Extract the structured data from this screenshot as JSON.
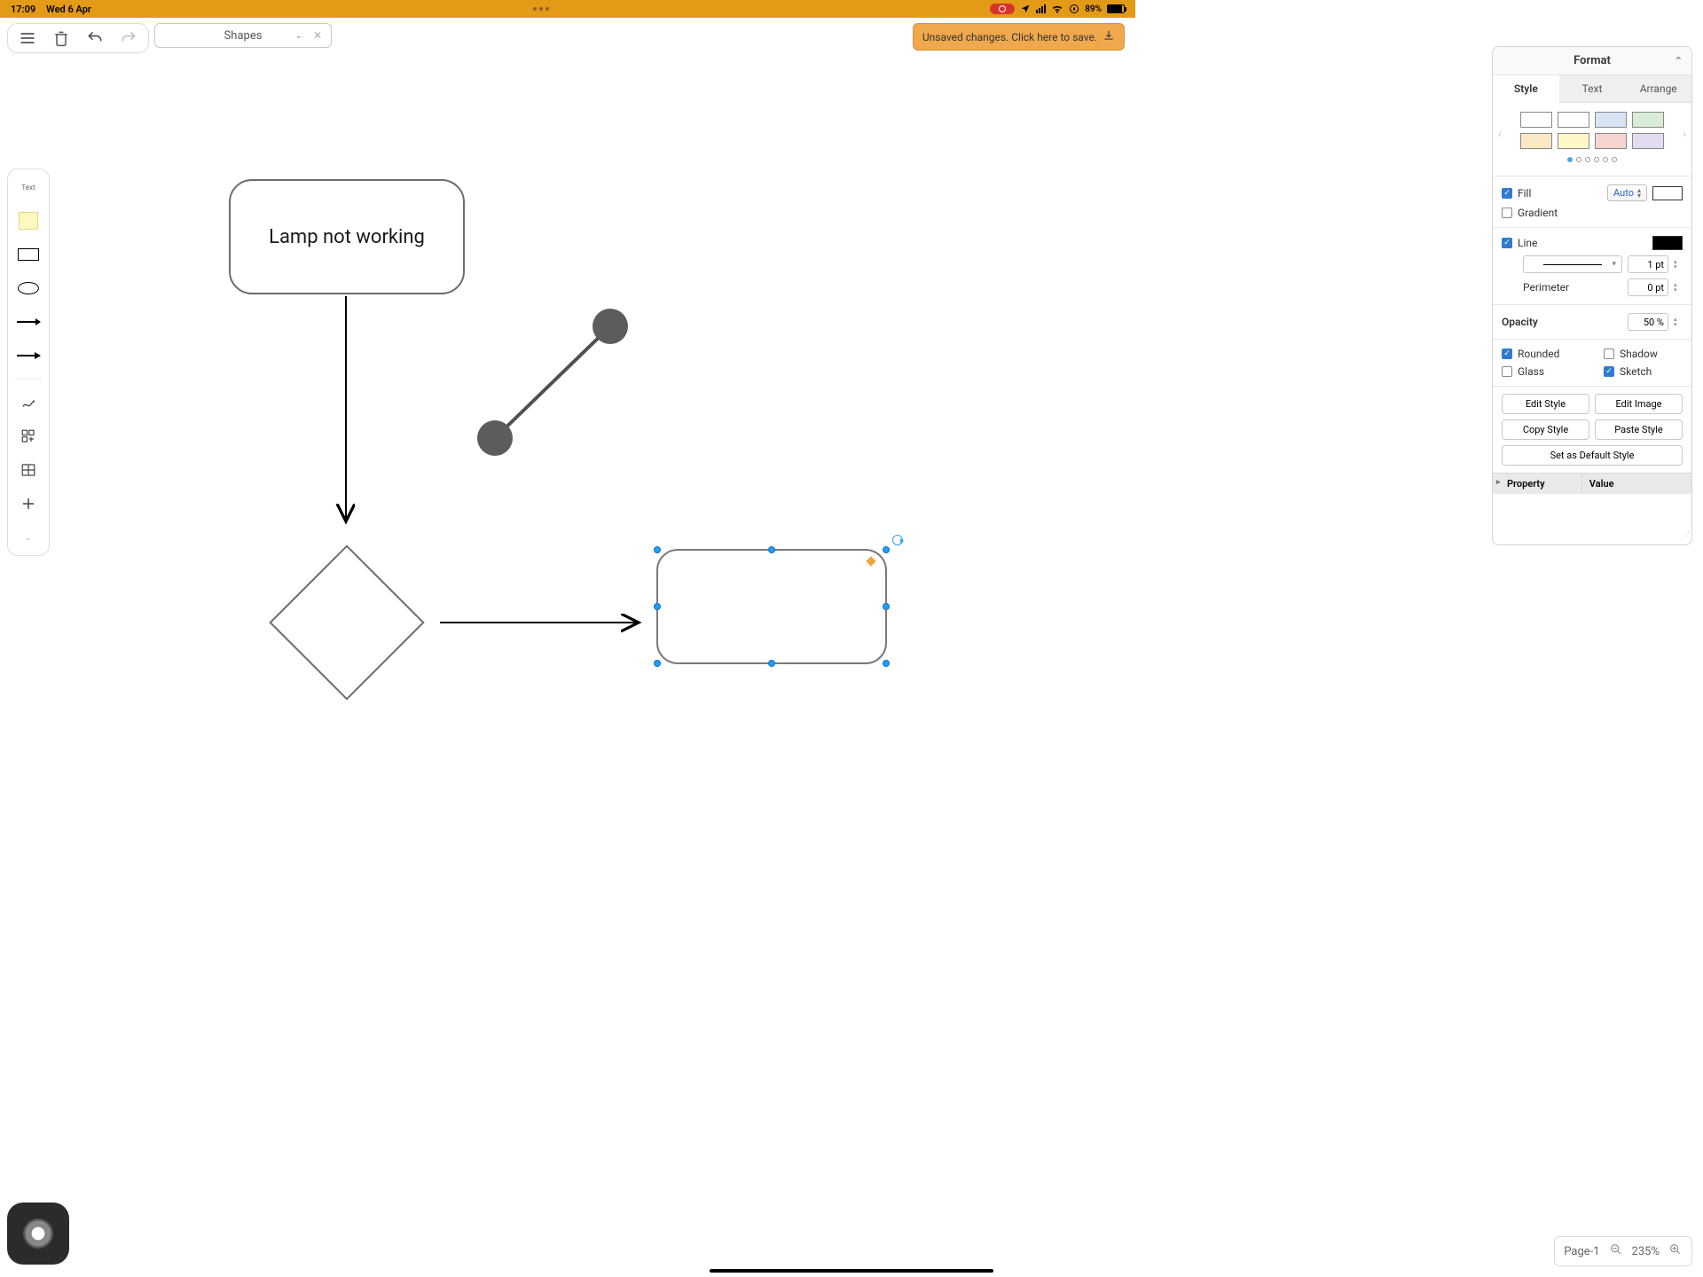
{
  "status": {
    "time": "17:09",
    "date": "Wed 6 Apr",
    "battery_pct": "89%"
  },
  "toolbar": {
    "shapes_label": "Shapes",
    "save_msg": "Unsaved changes. Click here to save."
  },
  "sidebar": {
    "text_label": "Text"
  },
  "canvas": {
    "lamp_text": "Lamp not working"
  },
  "format": {
    "title": "Format",
    "tabs": {
      "style": "Style",
      "text": "Text",
      "arrange": "Arrange"
    },
    "palette": [
      [
        "#ffffff",
        "#ffffff",
        "#d6e4f4",
        "#d8ecd7"
      ],
      [
        "#fbe8c5",
        "#fff7c8",
        "#f6d4d0",
        "#e3dcf0"
      ]
    ],
    "fill": {
      "label": "Fill",
      "mode": "Auto",
      "color": "#ffffff"
    },
    "gradient_label": "Gradient",
    "line": {
      "label": "Line",
      "color": "#000000",
      "width": "1 pt",
      "perimeter_label": "Perimeter",
      "perimeter": "0 pt"
    },
    "opacity": {
      "label": "Opacity",
      "value": "50 %"
    },
    "checks": {
      "rounded": "Rounded",
      "shadow": "Shadow",
      "glass": "Glass",
      "sketch": "Sketch"
    },
    "buttons": {
      "edit_style": "Edit Style",
      "edit_image": "Edit Image",
      "copy_style": "Copy Style",
      "paste_style": "Paste Style",
      "set_default": "Set as Default Style"
    },
    "prop_header": {
      "property": "Property",
      "value": "Value"
    }
  },
  "footer": {
    "page": "Page-1",
    "zoom": "235%"
  }
}
